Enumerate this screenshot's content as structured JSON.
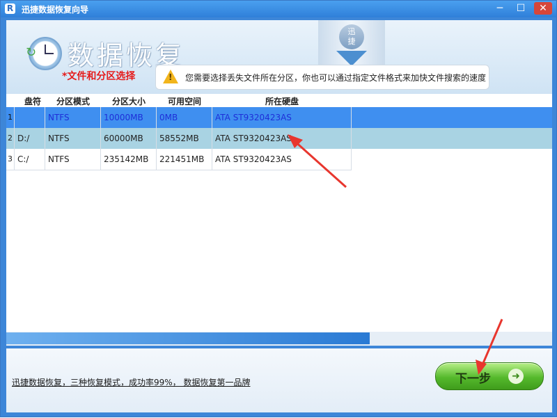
{
  "window": {
    "title": "迅捷数据恢复向导",
    "app_icon": "R"
  },
  "header": {
    "title": "数据恢复",
    "step_label": "*文件和分区选择",
    "logo_text": "迅\n捷",
    "hint": "您需要选择丢失文件所在分区，你也可以通过指定文件格式来加快文件搜索的速度"
  },
  "table": {
    "columns": [
      "盘符",
      "分区模式",
      "分区大小",
      "可用空间",
      "所在硬盘"
    ],
    "rows": [
      {
        "index": "1",
        "drive": "",
        "mode": "NTFS",
        "size": "10000MB",
        "free": "0MB",
        "disk": "ATA ST9320423AS"
      },
      {
        "index": "2",
        "drive": "D:/",
        "mode": "NTFS",
        "size": "60000MB",
        "free": "58552MB",
        "disk": "ATA ST9320423AS"
      },
      {
        "index": "3",
        "drive": "C:/",
        "mode": "NTFS",
        "size": "235142MB",
        "free": "221451MB",
        "disk": "ATA ST9320423AS"
      }
    ]
  },
  "footer": {
    "slogan": "迅捷数据恢复，三种恢复模式，成功率99%， 数据恢复第一品牌",
    "next_label": "下一步"
  },
  "colors": {
    "title_bar": "#2f7fd9",
    "selected_row": "#3f8ff0",
    "hover_row": "#a9d3e3",
    "next_button": "#55b92c",
    "step_label": "#e51b1b"
  },
  "icons": [
    "app-logo-icon",
    "minimize-icon",
    "maximize-icon",
    "close-icon",
    "clock-icon",
    "warning-icon",
    "arrow-right-icon"
  ]
}
